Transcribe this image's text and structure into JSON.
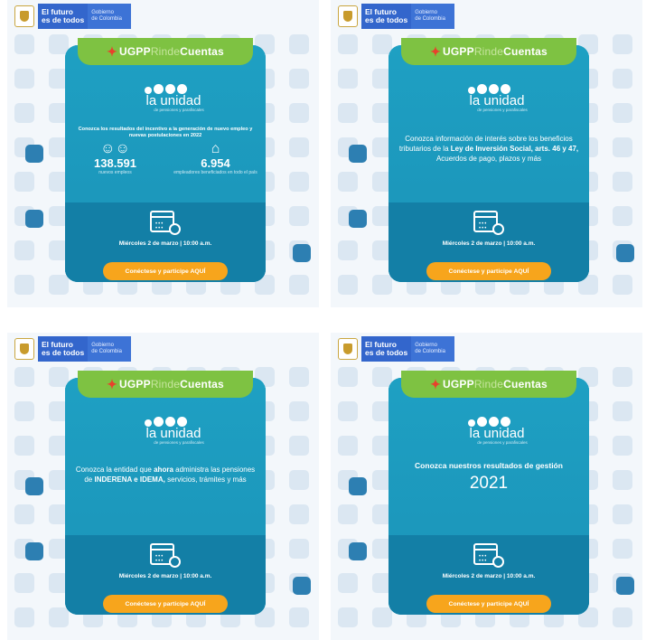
{
  "gov": {
    "line1": "El futuro\nes de todos",
    "line2": "Gobierno\nde Colombia"
  },
  "brand": {
    "prefix": "UGPP",
    "middle": "Rinde",
    "suffix": "Cuentas"
  },
  "logo": {
    "name": "la unidad",
    "sub": "de pensiones y parafiscales"
  },
  "date_text": "Miércoles 2 de marzo | 10:00 a.m.",
  "cta_label": "Conéctese y participe AQUÍ",
  "posts": [
    {
      "message": "Conozca los resultados del incentivo a la generación de nuevo empleo y nuevas postulaciones en 2022",
      "stats": [
        {
          "value": "138.591",
          "label": "nuevos empleos"
        },
        {
          "value": "6.954",
          "label": "empleadores beneficiados en todo el país"
        }
      ]
    },
    {
      "message_parts": [
        "Conozca información de interés sobre los beneficios tributarios de la ",
        "Ley de Inversión Social, arts. 46 y 47,",
        " Acuerdos de pago, plazos y más"
      ]
    },
    {
      "message_parts": [
        "Conozca la entidad que ",
        "ahora",
        " administra las pensiones de ",
        "INDERENA e IDEMA,",
        " servicios, trámites y más"
      ]
    },
    {
      "message": "Conozca nuestros resultados de gestión",
      "year": "2021"
    }
  ],
  "colors": {
    "card": "#1e9bbf",
    "card_dark": "#137fa6",
    "banner": "#7ec242",
    "cta": "#f7a51c",
    "gov_blue": "#3366cc"
  }
}
